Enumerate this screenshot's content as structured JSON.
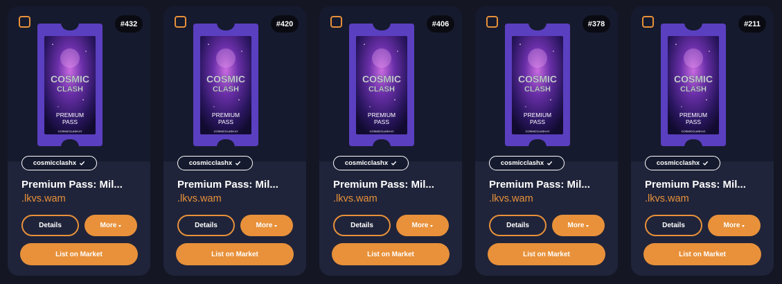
{
  "theme": {
    "accent": "#e8913a",
    "card_bg": "#20243a",
    "card_top_bg": "#161a2e",
    "page_bg": "#141624",
    "ticket_frame": "#5a3fc0"
  },
  "ticket_art": {
    "line1": "COSMIC",
    "line2": "CLASH",
    "line3": "PREMIUM",
    "line4": "PASS",
    "footer": "COSMICCLASH.IO"
  },
  "cards": [
    {
      "number": "#432",
      "collection": "cosmicclashx",
      "title": "Premium Pass: Mil...",
      "owner": ".lkvs.wam",
      "details_label": "Details",
      "more_label": "More",
      "list_label": "List on Market"
    },
    {
      "number": "#420",
      "collection": "cosmicclashx",
      "title": "Premium Pass: Mil...",
      "owner": ".lkvs.wam",
      "details_label": "Details",
      "more_label": "More",
      "list_label": "List on Market"
    },
    {
      "number": "#406",
      "collection": "cosmicclashx",
      "title": "Premium Pass: Mil...",
      "owner": ".lkvs.wam",
      "details_label": "Details",
      "more_label": "More",
      "list_label": "List on Market"
    },
    {
      "number": "#378",
      "collection": "cosmicclashx",
      "title": "Premium Pass: Mil...",
      "owner": ".lkvs.wam",
      "details_label": "Details",
      "more_label": "More",
      "list_label": "List on Market"
    },
    {
      "number": "#211",
      "collection": "cosmicclashx",
      "title": "Premium Pass: Mil...",
      "owner": ".lkvs.wam",
      "details_label": "Details",
      "more_label": "More",
      "list_label": "List on Market"
    }
  ]
}
